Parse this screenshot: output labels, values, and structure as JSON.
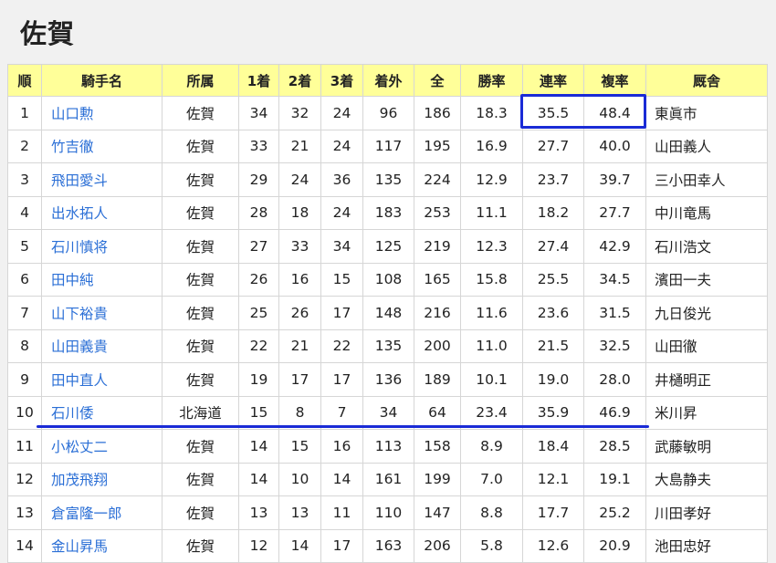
{
  "title": "佐賀",
  "table": {
    "headers": [
      "順",
      "騎手名",
      "所属",
      "1着",
      "2着",
      "3着",
      "着外",
      "全",
      "勝率",
      "連率",
      "複率",
      "厩舎"
    ],
    "rows": [
      [
        "1",
        "山口勲",
        "佐賀",
        "34",
        "32",
        "24",
        "96",
        "186",
        "18.3",
        "35.5",
        "48.4",
        "東眞市"
      ],
      [
        "2",
        "竹吉徹",
        "佐賀",
        "33",
        "21",
        "24",
        "117",
        "195",
        "16.9",
        "27.7",
        "40.0",
        "山田義人"
      ],
      [
        "3",
        "飛田愛斗",
        "佐賀",
        "29",
        "24",
        "36",
        "135",
        "224",
        "12.9",
        "23.7",
        "39.7",
        "三小田幸人"
      ],
      [
        "4",
        "出水拓人",
        "佐賀",
        "28",
        "18",
        "24",
        "183",
        "253",
        "11.1",
        "18.2",
        "27.7",
        "中川竜馬"
      ],
      [
        "5",
        "石川慎将",
        "佐賀",
        "27",
        "33",
        "34",
        "125",
        "219",
        "12.3",
        "27.4",
        "42.9",
        "石川浩文"
      ],
      [
        "6",
        "田中純",
        "佐賀",
        "26",
        "16",
        "15",
        "108",
        "165",
        "15.8",
        "25.5",
        "34.5",
        "濱田一夫"
      ],
      [
        "7",
        "山下裕貴",
        "佐賀",
        "25",
        "26",
        "17",
        "148",
        "216",
        "11.6",
        "23.6",
        "31.5",
        "九日俊光"
      ],
      [
        "8",
        "山田義貴",
        "佐賀",
        "22",
        "21",
        "22",
        "135",
        "200",
        "11.0",
        "21.5",
        "32.5",
        "山田徹"
      ],
      [
        "9",
        "田中直人",
        "佐賀",
        "19",
        "17",
        "17",
        "136",
        "189",
        "10.1",
        "19.0",
        "28.0",
        "井樋明正"
      ],
      [
        "10",
        "石川倭",
        "北海道",
        "15",
        "8",
        "7",
        "34",
        "64",
        "23.4",
        "35.9",
        "46.9",
        "米川昇"
      ],
      [
        "11",
        "小松丈二",
        "佐賀",
        "14",
        "15",
        "16",
        "113",
        "158",
        "8.9",
        "18.4",
        "28.5",
        "武藤敏明"
      ],
      [
        "12",
        "加茂飛翔",
        "佐賀",
        "14",
        "10",
        "14",
        "161",
        "199",
        "7.0",
        "12.1",
        "19.1",
        "大島静夫"
      ],
      [
        "13",
        "倉富隆一郎",
        "佐賀",
        "13",
        "13",
        "11",
        "110",
        "147",
        "8.8",
        "17.7",
        "25.2",
        "川田孝好"
      ],
      [
        "14",
        "金山昇馬",
        "佐賀",
        "12",
        "14",
        "17",
        "163",
        "206",
        "5.8",
        "12.6",
        "20.9",
        "池田忠好"
      ]
    ]
  },
  "annotation_color": "#1a2bd6"
}
